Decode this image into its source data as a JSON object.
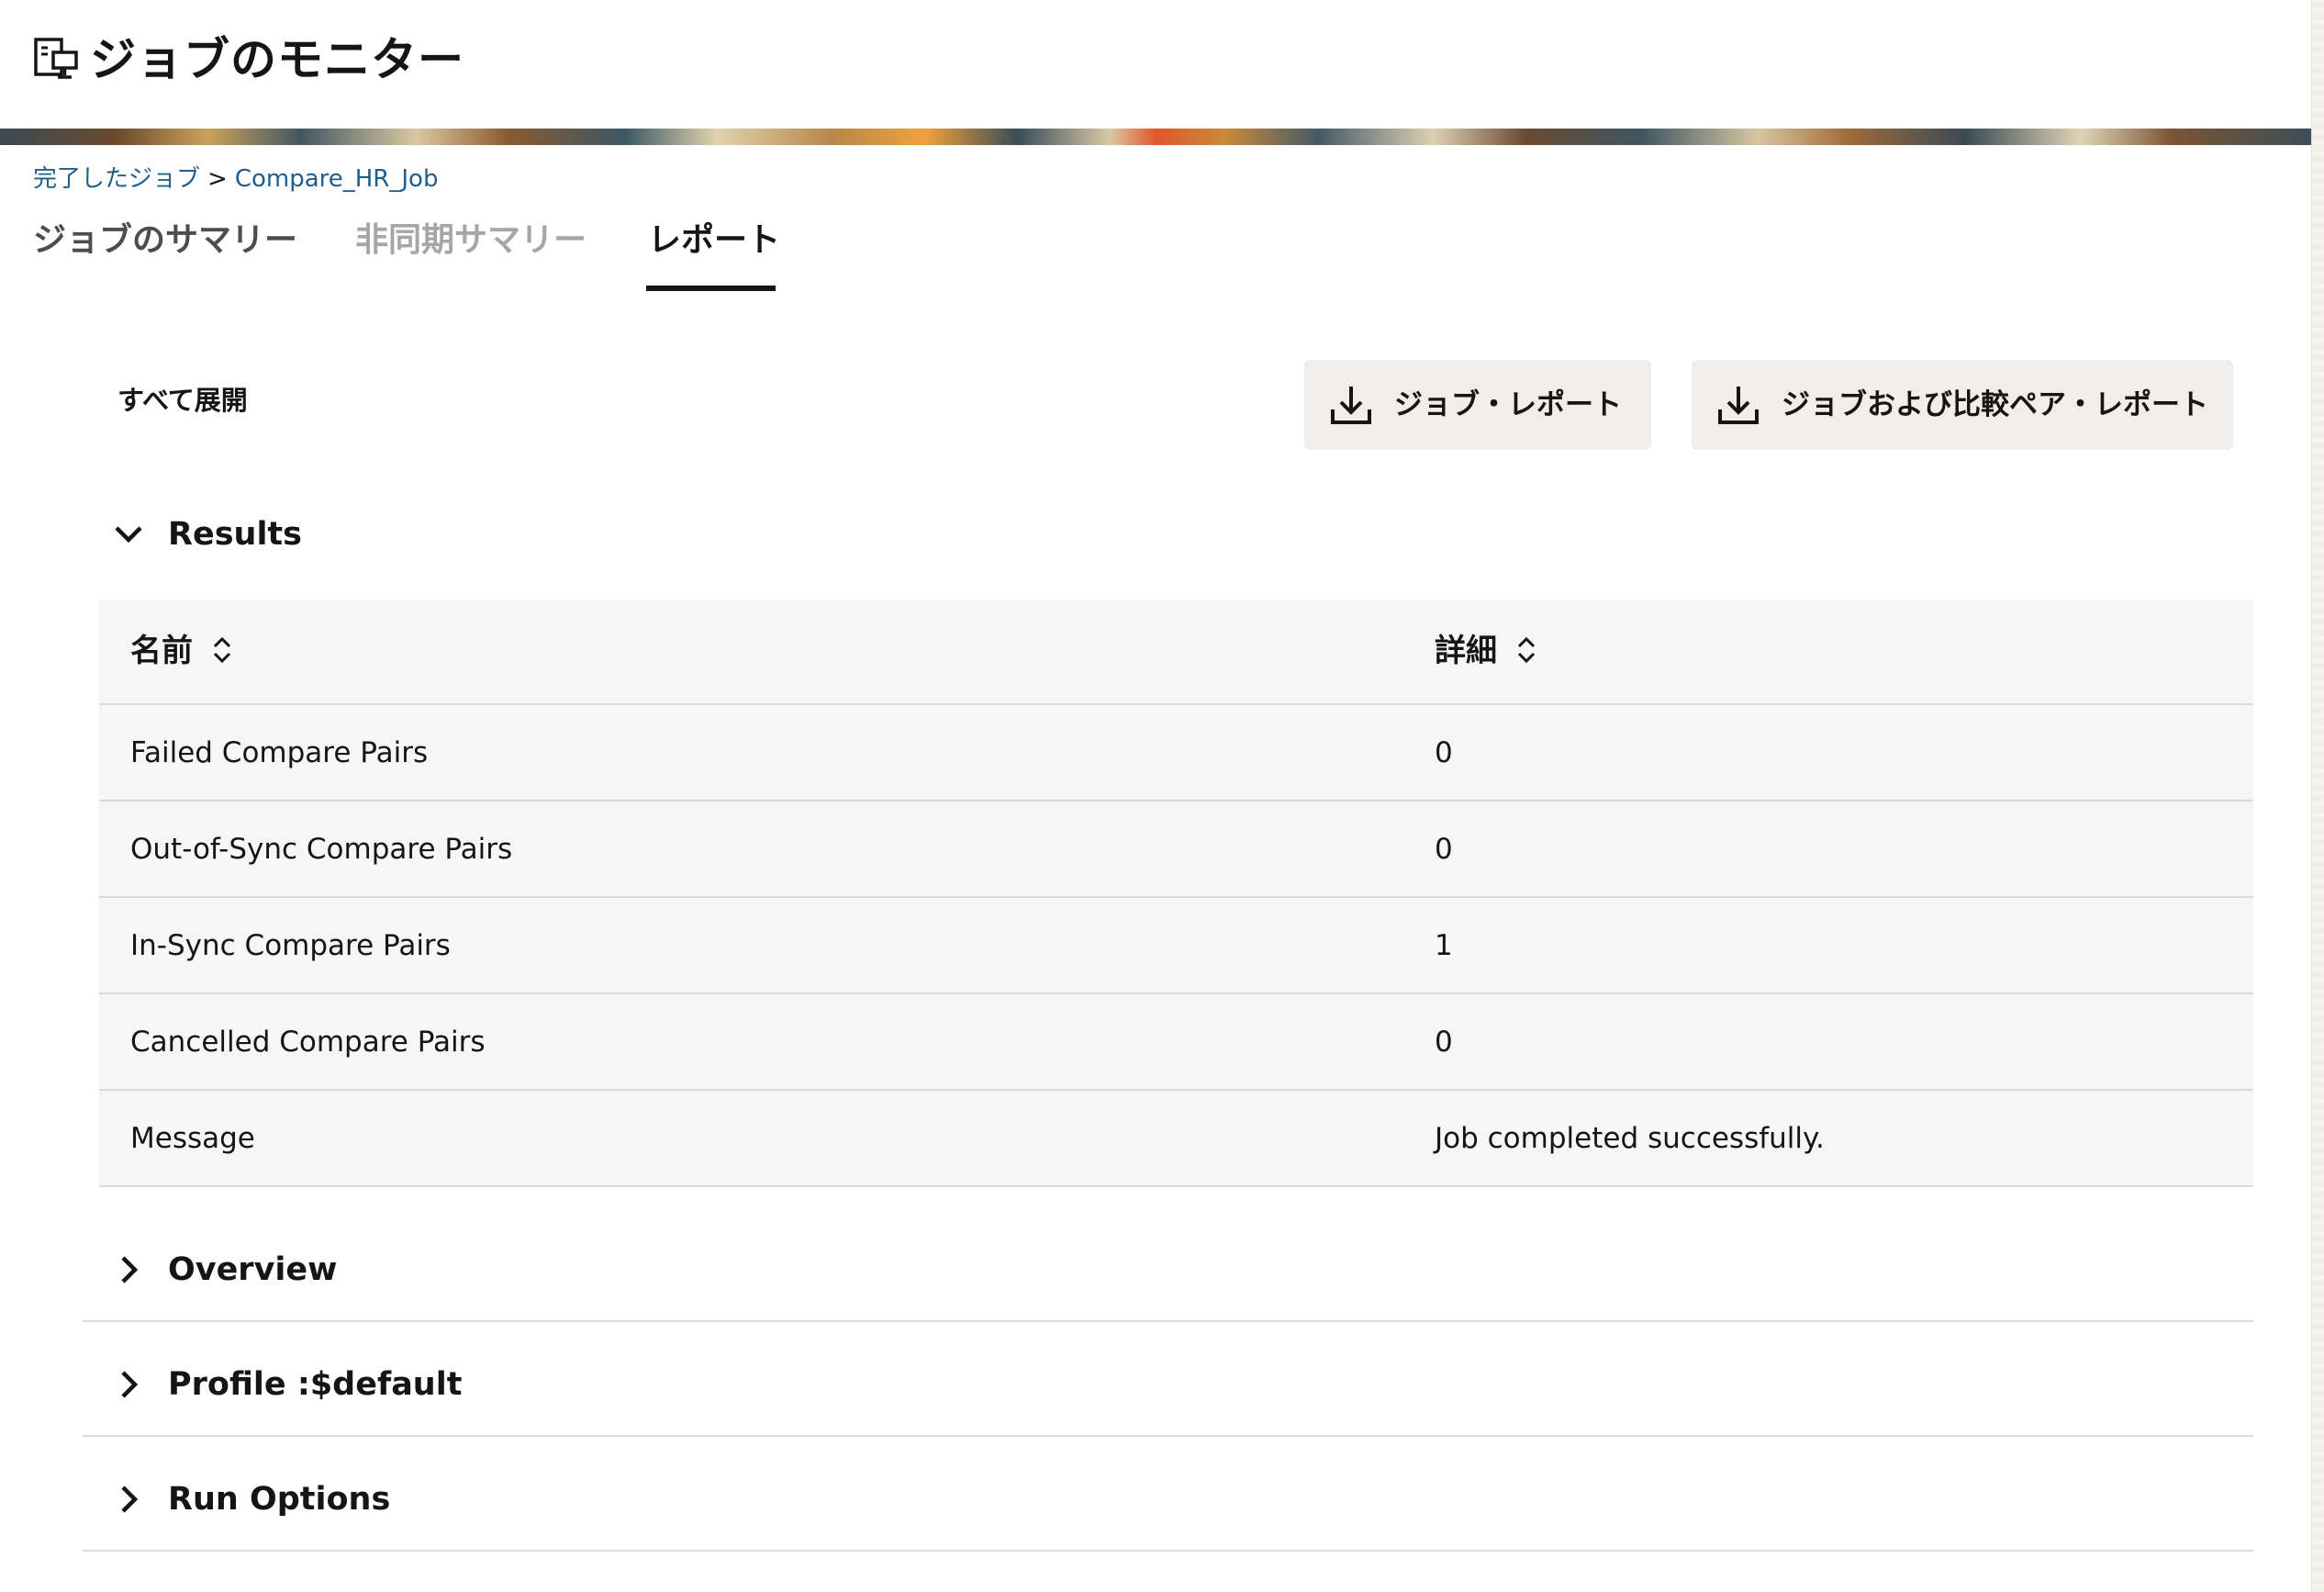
{
  "header": {
    "title": "ジョブのモニター",
    "icon": "job-monitor-icon"
  },
  "breadcrumb": {
    "parent": "完了したジョブ",
    "separator": ">",
    "current": "Compare_HR_Job"
  },
  "tabs": [
    {
      "label": "ジョブのサマリー",
      "state": "default"
    },
    {
      "label": "非同期サマリー",
      "state": "disabled"
    },
    {
      "label": "レポート",
      "state": "selected"
    }
  ],
  "toolbar": {
    "expand_all": "すべて展開",
    "download_job_report": "ジョブ・レポート",
    "download_job_and_pairs_report": "ジョブおよび比較ペア・レポート"
  },
  "sections": {
    "results": {
      "title": "Results",
      "expanded": true
    },
    "overview": {
      "title": "Overview",
      "expanded": false
    },
    "profile": {
      "title": "Profile :$default",
      "expanded": false
    },
    "run_options": {
      "title": "Run Options",
      "expanded": false
    }
  },
  "table": {
    "columns": [
      "名前",
      "詳細"
    ],
    "rows": [
      {
        "name": "Failed Compare Pairs",
        "detail": "0"
      },
      {
        "name": "Out-of-Sync Compare Pairs",
        "detail": "0"
      },
      {
        "name": "In-Sync Compare Pairs",
        "detail": "1"
      },
      {
        "name": "Cancelled Compare Pairs",
        "detail": "0"
      },
      {
        "name": "Message",
        "detail": "Job completed successfully."
      }
    ]
  },
  "colors": {
    "link": "#1f5f8a",
    "text": "#161513",
    "tab_disabled": "#a6a6a6",
    "button_bg": "#efeeec",
    "table_bg": "#f6f6f6"
  }
}
